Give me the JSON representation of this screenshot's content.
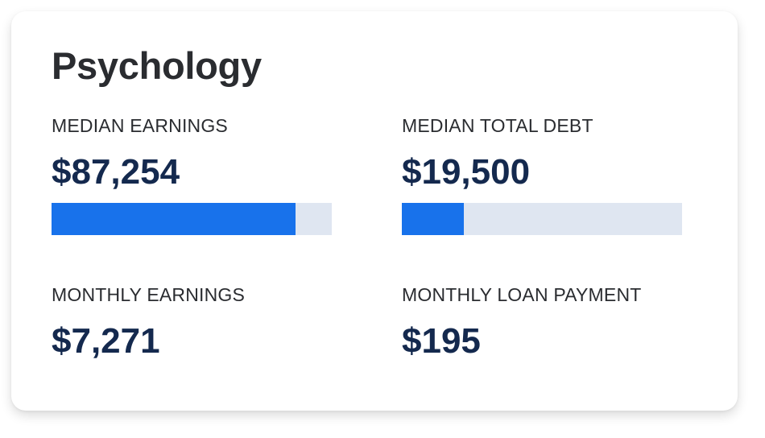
{
  "card": {
    "title": "Psychology",
    "stats": {
      "median_earnings": {
        "label": "MEDIAN EARNINGS",
        "value": "$87,254",
        "bar_fraction": 0.87
      },
      "median_total_debt": {
        "label": "MEDIAN TOTAL DEBT",
        "value": "$19,500",
        "bar_fraction": 0.22
      },
      "monthly_earnings": {
        "label": "MONTHLY EARNINGS",
        "value": "$7,271"
      },
      "monthly_loan_payment": {
        "label": "MONTHLY LOAN PAYMENT",
        "value": "$195"
      }
    }
  },
  "colors": {
    "bar_fill": "#1872eb",
    "bar_track": "#dfe6f1",
    "value_text": "#14294e",
    "label_text": "#2a2c30"
  }
}
